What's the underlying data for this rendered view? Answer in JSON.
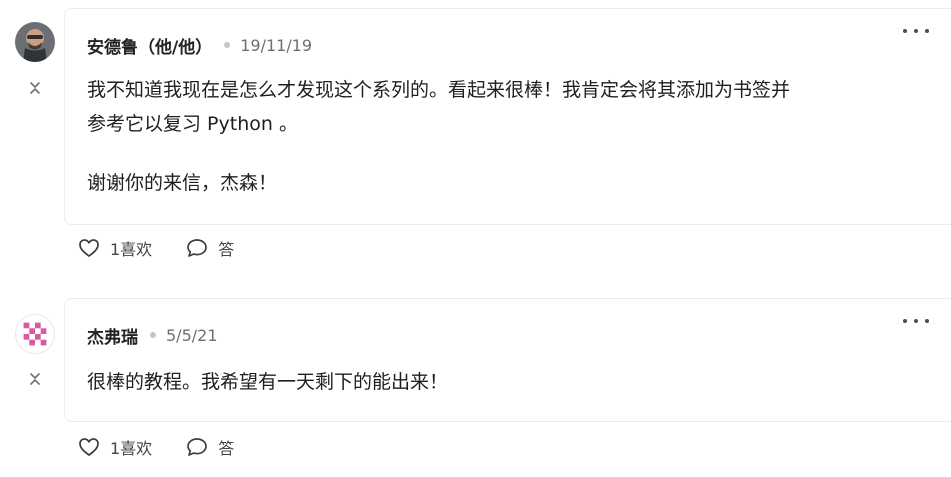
{
  "comments": [
    {
      "author": "安德鲁（他/他）",
      "date": "19/11/19",
      "body_lines": [
        "我不知道我现在是怎么才发现这个系列的。看起来很棒！我肯定会将其添加为书签并",
        "参考它以复习 Python 。",
        "谢谢你的来信，杰森！"
      ],
      "like_label": "1喜欢",
      "reply_label": "答"
    },
    {
      "author": "杰弗瑞",
      "date": "5/5/21",
      "body_lines": [
        "很棒的教程。我希望有一天剩下的能出来！"
      ],
      "like_label": "1喜欢",
      "reply_label": "答"
    }
  ],
  "icons": {
    "more": "more-icon",
    "like": "heart-icon",
    "reply": "reply-bubble-icon",
    "collapse": "collapse-chevron-icon"
  },
  "colors": {
    "card_border": "#ececec",
    "text": "#1f1f1f",
    "muted": "#6f6f6f",
    "dot": "#c6c6c6",
    "avatar_pattern": "#d65aa5"
  }
}
